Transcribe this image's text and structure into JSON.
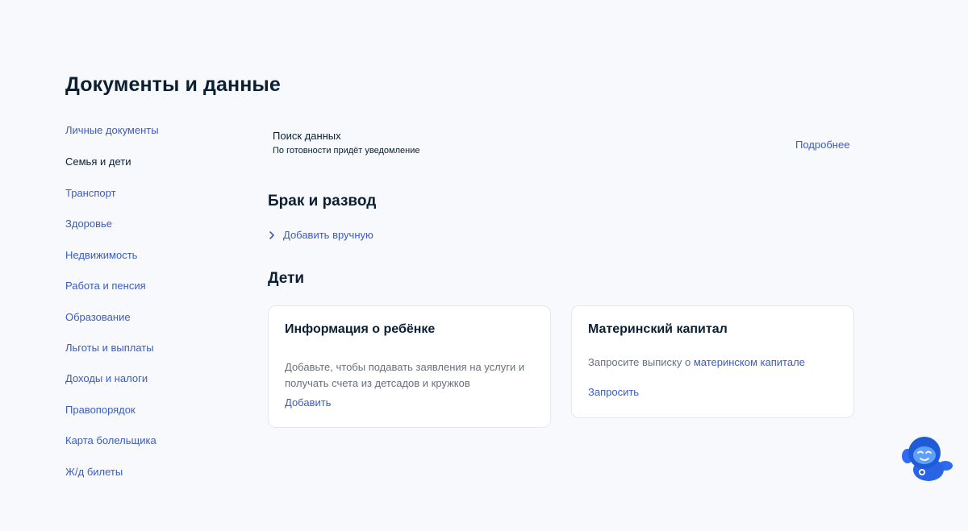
{
  "page": {
    "title": "Документы и данные"
  },
  "sidebar": {
    "items": [
      {
        "label": "Личные документы",
        "active": false
      },
      {
        "label": "Семья и дети",
        "active": true
      },
      {
        "label": "Транспорт",
        "active": false
      },
      {
        "label": "Здоровье",
        "active": false
      },
      {
        "label": "Недвижимость",
        "active": false
      },
      {
        "label": "Работа и пенсия",
        "active": false
      },
      {
        "label": "Образование",
        "active": false
      },
      {
        "label": "Льготы и выплаты",
        "active": false
      },
      {
        "label": "Доходы и налоги",
        "active": false
      },
      {
        "label": "Правопорядок",
        "active": false
      },
      {
        "label": "Карта болельщика",
        "active": false
      },
      {
        "label": "Ж/д билеты",
        "active": false
      }
    ]
  },
  "status": {
    "title": "Поиск данных",
    "subtitle": "По готовности придёт уведомление",
    "more_link": "Подробнее"
  },
  "marriage": {
    "title": "Брак и развод",
    "add_manually": "Добавить вручную"
  },
  "children": {
    "title": "Дети",
    "child_card": {
      "title": "Информация о ребёнке",
      "description": "Добавьте, чтобы подавать заявления на услуги и получать счета из детсадов и кружков",
      "action": "Добавить"
    },
    "capital_card": {
      "title": "Материнский капитал",
      "description_prefix": "Запросите выписку о ",
      "description_link": "материнском капитале",
      "action": "Запросить"
    }
  },
  "assistant": {
    "icon": "robot-assistant-icon"
  },
  "colors": {
    "background": "#f8f9fc",
    "link": "#3a5cc5",
    "text": "#0b1f33",
    "muted_text": "#66727f",
    "card_border": "#e3e8ee",
    "robot_blue": "#1e5bd8"
  }
}
